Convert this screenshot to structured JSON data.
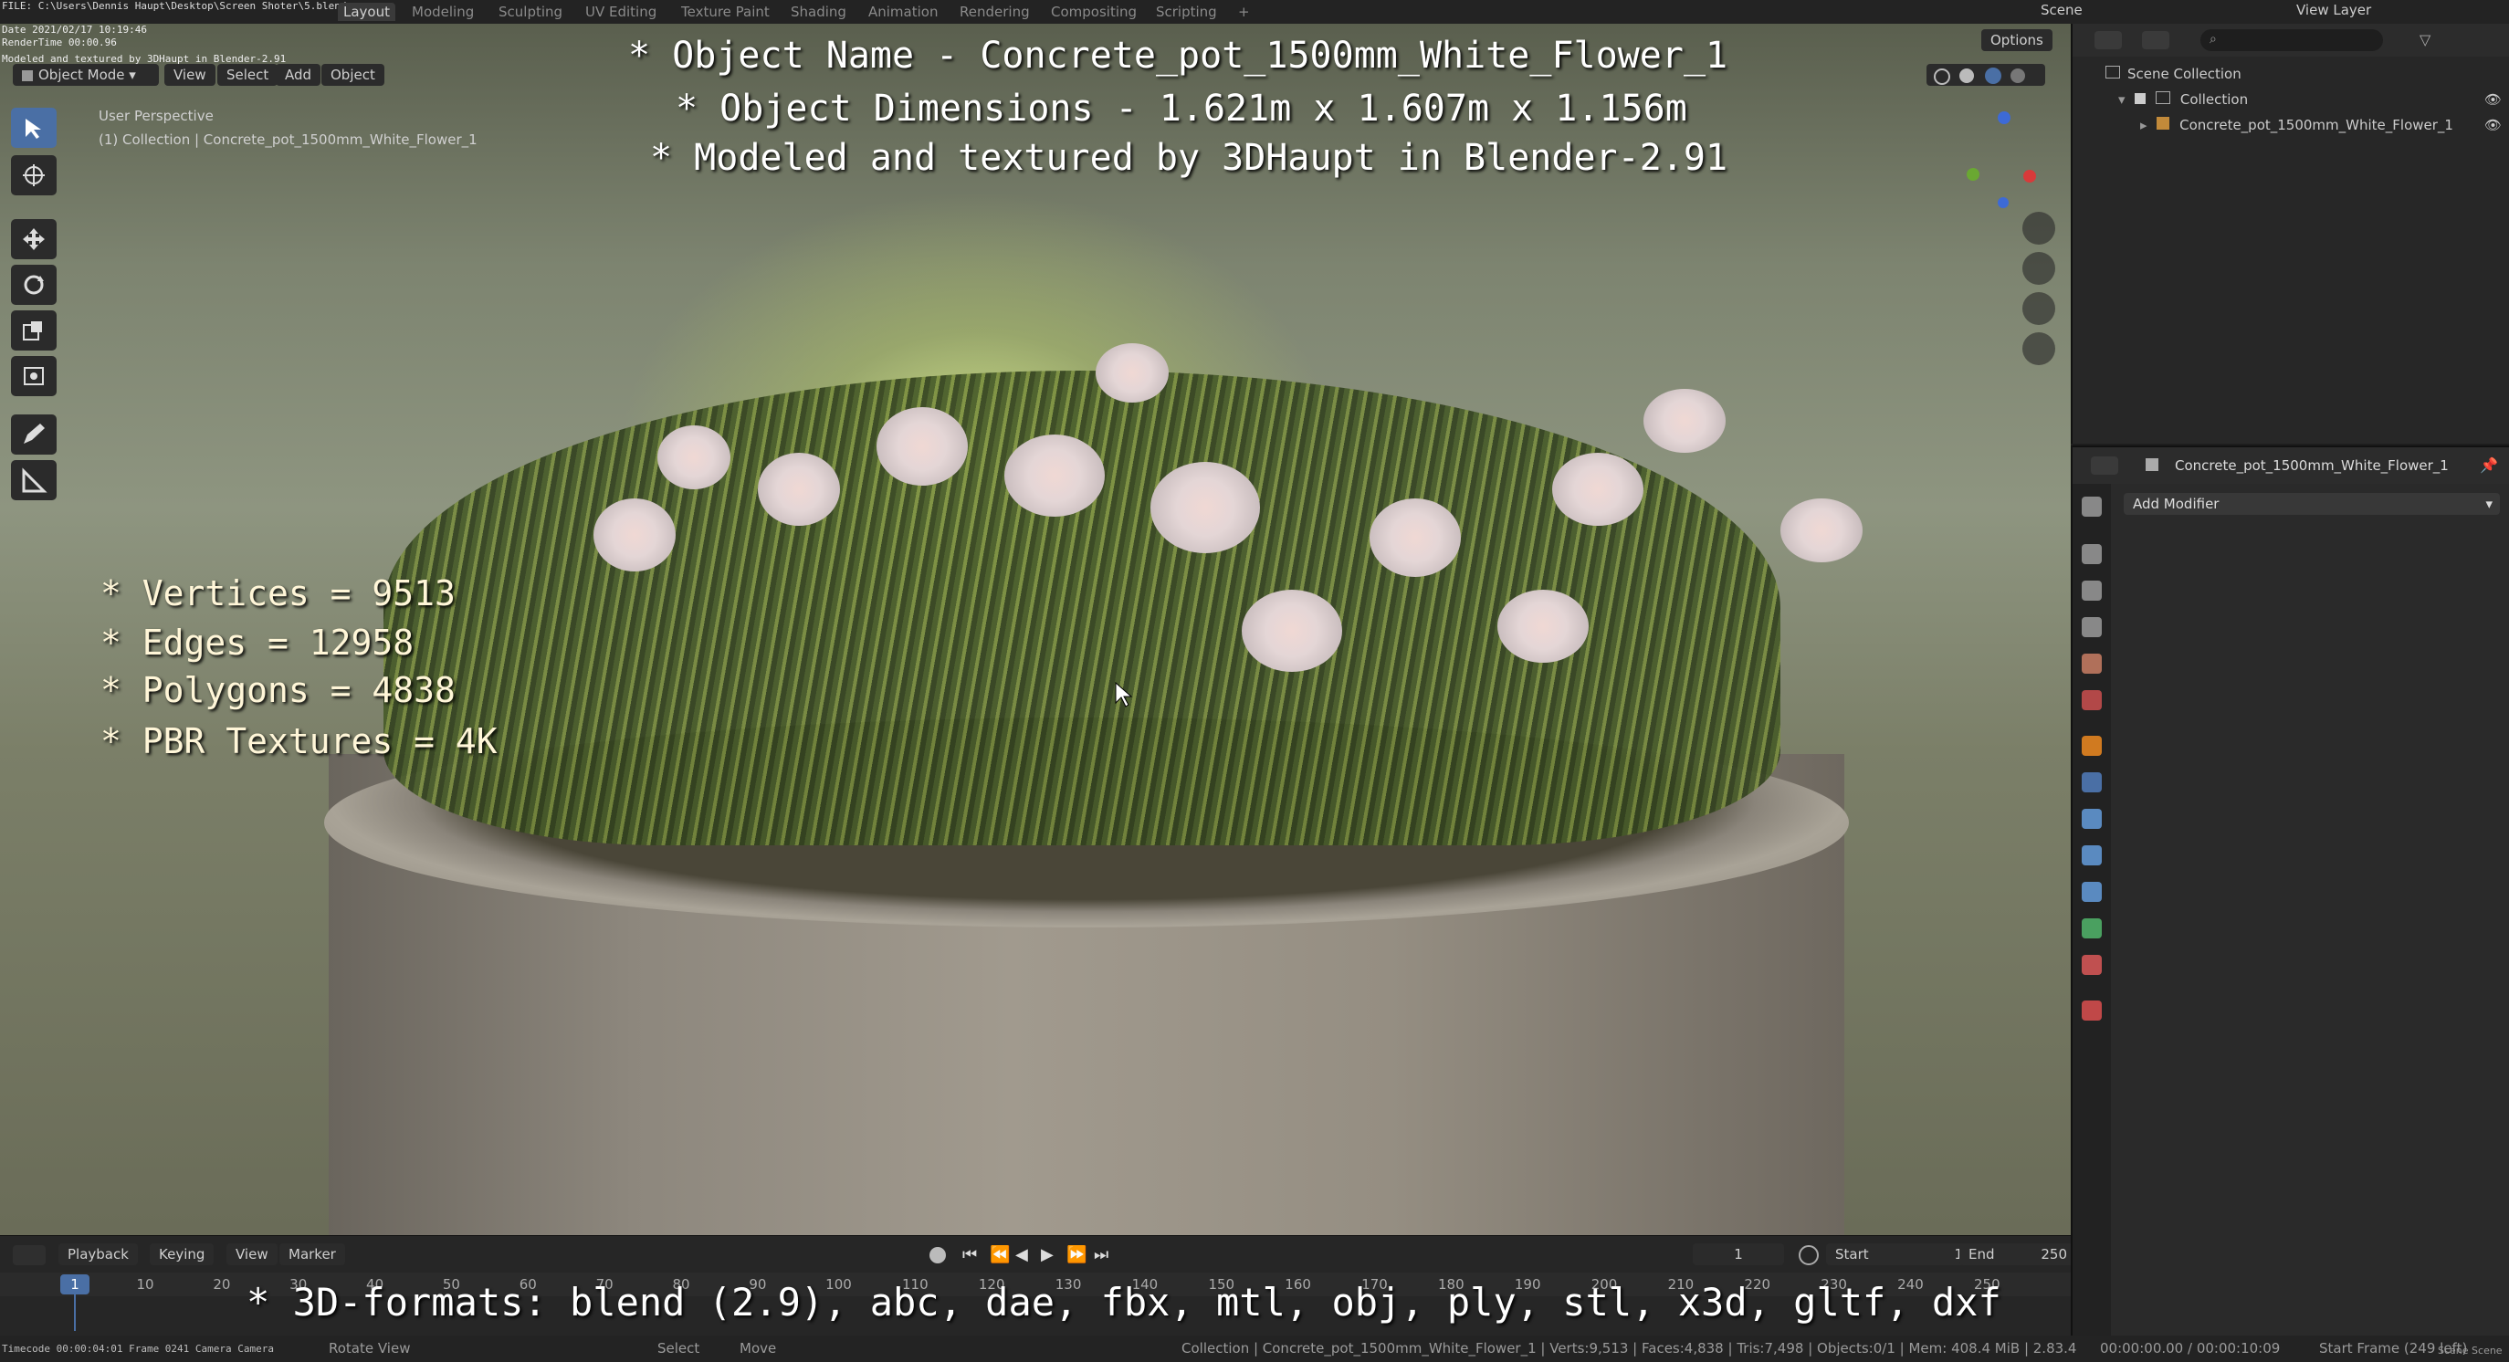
{
  "topbar": {
    "file_path": "FILE: C:\\Users\\Dennis Haupt\\Desktop\\Screen Shoter\\5.blend",
    "date": "Date 2021/02/17 10:19:46",
    "render_time": "RenderTime 00:00.96",
    "credit_small": "Modeled and textured by 3DHaupt in Blender-2.91",
    "workspaces": [
      "Layout",
      "Modeling",
      "Sculpting",
      "UV Editing",
      "Texture Paint",
      "Shading",
      "Animation",
      "Rendering",
      "Compositing",
      "Scripting"
    ],
    "add_tab": "+",
    "scene_label": "Scene",
    "view_layer_label": "View Layer"
  },
  "viewport": {
    "mode": "Object Mode",
    "menus": [
      "View",
      "Select",
      "Add",
      "Object"
    ],
    "options": "Options",
    "perspective": "User Perspective",
    "collection_path": "(1) Collection | Concrete_pot_1500mm_White_Flower_1",
    "overlay": {
      "line1": "* Object Name - Concrete_pot_1500mm_White_Flower_1",
      "line2": "* Object Dimensions -  1.621m x 1.607m x 1.156m",
      "line3": "* Modeled and textured by 3DHaupt in Blender-2.91"
    },
    "stats": [
      "* Vertices = 9513",
      "* Edges = 12958",
      "* Polygons = 4838",
      "* PBR Textures = 4K"
    ],
    "formats": "* 3D-formats: blend (2.9), abc, dae, fbx, mtl, obj, ply, stl, x3d, gltf, dxf"
  },
  "timeline": {
    "menus": [
      "Playback",
      "Keying",
      "View",
      "Marker"
    ],
    "current_frame": "1",
    "start_label": "Start",
    "start_value": "1",
    "end_label": "End",
    "end_value": "250",
    "ruler": [
      "1",
      "10",
      "20",
      "30",
      "40",
      "50",
      "60",
      "70",
      "80",
      "90",
      "100",
      "110",
      "120",
      "130",
      "140",
      "150",
      "160",
      "170",
      "180",
      "190",
      "200",
      "210",
      "220",
      "230",
      "240",
      "250"
    ]
  },
  "statusbar": {
    "left": "Timecode 00:00:04:01  Frame 0241  Camera Camera",
    "rotate": "Rotate View",
    "select": "Select",
    "move": "Move",
    "info": "Collection | Concrete_pot_1500mm_White_Flower_1 | Verts:9,513 | Faces:4,838 | Tris:7,498 | Objects:0/1 | Mem: 408.4 MiB | 2.83.4",
    "time": "00:00:00.00 / 00:00:10:09",
    "start_frame": "Start Frame (249 left)",
    "scene": "Scene Scene"
  },
  "outliner": {
    "scene_collection": "Scene Collection",
    "collection": "Collection",
    "object": "Concrete_pot_1500mm_White_Flower_1"
  },
  "properties": {
    "object_name": "Concrete_pot_1500mm_White_Flower_1",
    "add_modifier": "Add Modifier"
  },
  "colors": {
    "accent": "#4a6fa5",
    "panel": "#2a2a2a",
    "overlay_text": "#ffffff"
  }
}
